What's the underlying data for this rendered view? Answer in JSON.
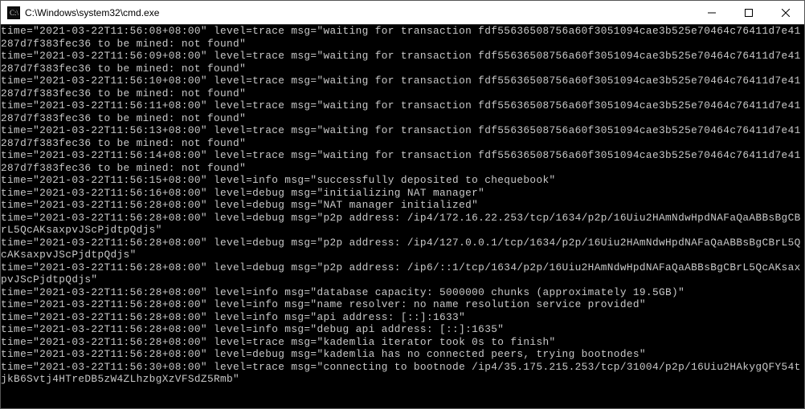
{
  "window": {
    "title": "C:\\Windows\\system32\\cmd.exe"
  },
  "controls": {
    "minimize": "—",
    "maximize": "☐",
    "close": "✕"
  },
  "terminal_lines": [
    "time=\"2021-03-22T11:56:08+08:00\" level=trace msg=\"waiting for transaction fdf55636508756a60f3051094cae3b525e70464c76411d7e41287d7f383fec36 to be mined: not found\"",
    "time=\"2021-03-22T11:56:09+08:00\" level=trace msg=\"waiting for transaction fdf55636508756a60f3051094cae3b525e70464c76411d7e41287d7f383fec36 to be mined: not found\"",
    "time=\"2021-03-22T11:56:10+08:00\" level=trace msg=\"waiting for transaction fdf55636508756a60f3051094cae3b525e70464c76411d7e41287d7f383fec36 to be mined: not found\"",
    "time=\"2021-03-22T11:56:11+08:00\" level=trace msg=\"waiting for transaction fdf55636508756a60f3051094cae3b525e70464c76411d7e41287d7f383fec36 to be mined: not found\"",
    "time=\"2021-03-22T11:56:13+08:00\" level=trace msg=\"waiting for transaction fdf55636508756a60f3051094cae3b525e70464c76411d7e41287d7f383fec36 to be mined: not found\"",
    "time=\"2021-03-22T11:56:14+08:00\" level=trace msg=\"waiting for transaction fdf55636508756a60f3051094cae3b525e70464c76411d7e41287d7f383fec36 to be mined: not found\"",
    "time=\"2021-03-22T11:56:15+08:00\" level=info msg=\"successfully deposited to chequebook\"",
    "time=\"2021-03-22T11:56:16+08:00\" level=debug msg=\"initializing NAT manager\"",
    "time=\"2021-03-22T11:56:28+08:00\" level=debug msg=\"NAT manager initialized\"",
    "time=\"2021-03-22T11:56:28+08:00\" level=debug msg=\"p2p address: /ip4/172.16.22.253/tcp/1634/p2p/16Uiu2HAmNdwHpdNAFaQaABBsBgCBrL5QcAKsaxpvJScPjdtpQdjs\"",
    "time=\"2021-03-22T11:56:28+08:00\" level=debug msg=\"p2p address: /ip4/127.0.0.1/tcp/1634/p2p/16Uiu2HAmNdwHpdNAFaQaABBsBgCBrL5QcAKsaxpvJScPjdtpQdjs\"",
    "time=\"2021-03-22T11:56:28+08:00\" level=debug msg=\"p2p address: /ip6/::1/tcp/1634/p2p/16Uiu2HAmNdwHpdNAFaQaABBsBgCBrL5QcAKsaxpvJScPjdtpQdjs\"",
    "time=\"2021-03-22T11:56:28+08:00\" level=info msg=\"database capacity: 5000000 chunks (approximately 19.5GB)\"",
    "time=\"2021-03-22T11:56:28+08:00\" level=info msg=\"name resolver: no name resolution service provided\"",
    "time=\"2021-03-22T11:56:28+08:00\" level=info msg=\"api address: [::]:1633\"",
    "time=\"2021-03-22T11:56:28+08:00\" level=info msg=\"debug api address: [::]:1635\"",
    "time=\"2021-03-22T11:56:28+08:00\" level=trace msg=\"kademlia iterator took 0s to finish\"",
    "time=\"2021-03-22T11:56:28+08:00\" level=debug msg=\"kademlia has no connected peers, trying bootnodes\"",
    "time=\"2021-03-22T11:56:30+08:00\" level=trace msg=\"connecting to bootnode /ip4/35.175.215.253/tcp/31004/p2p/16Uiu2HAkygQFY54tjkB6Svtj4HTreDB5zW4ZLhzbgXzVFSdZ5Rmb\""
  ]
}
